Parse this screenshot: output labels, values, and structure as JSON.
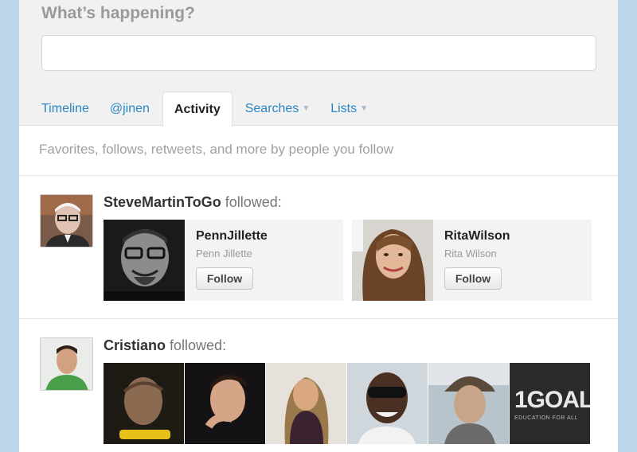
{
  "composer": {
    "prompt": "What’s happening?",
    "input_placeholder": ""
  },
  "tabs": [
    {
      "label": "Timeline"
    },
    {
      "label": "@jinen"
    },
    {
      "label": "Activity"
    },
    {
      "label": "Searches"
    },
    {
      "label": "Lists"
    }
  ],
  "activity": {
    "subtitle": "Favorites, follows, retweets, and more by people you follow",
    "events": [
      {
        "actor": "SteveMartinToGo",
        "verb": "followed:",
        "followed": [
          {
            "username": "PennJillette",
            "real_name": "Penn Jillette",
            "button": "Follow"
          },
          {
            "username": "RitaWilson",
            "real_name": "Rita Wilson",
            "button": "Follow"
          }
        ]
      },
      {
        "actor": "Cristiano",
        "verb": "followed:",
        "thumbs": [
          {
            "name": "user-photo-1"
          },
          {
            "name": "user-photo-2"
          },
          {
            "name": "user-photo-3"
          },
          {
            "name": "user-photo-4"
          },
          {
            "name": "user-photo-5"
          },
          {
            "name": "1goal-logo",
            "logo_text": "1GOAL",
            "logo_sub": "EDUCATION FOR ALL"
          }
        ]
      }
    ]
  },
  "colors": {
    "background": "#bcd6ea",
    "link": "#2a86c2",
    "composer_bg": "#f1f1f1"
  }
}
